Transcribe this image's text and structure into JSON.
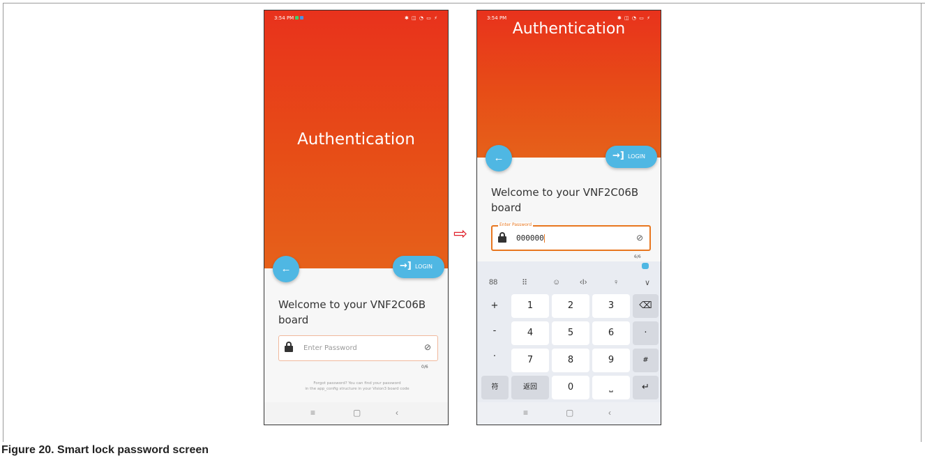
{
  "caption": "Figure 20.  Smart lock password screen",
  "status_bar": {
    "time": "3:54 PM",
    "icons": "✱ ◫ ◔ ▭ ⚡",
    "dot_colors": [
      "#3fd06a",
      "#4a90e2"
    ]
  },
  "screen1": {
    "title": "Authentication",
    "back_icon": "←",
    "login_icon": "→]",
    "login_label": "LOGIN",
    "welcome": "Welcome to your VNF2C06B board",
    "password_placeholder": "Enter Password",
    "eye_icon": "⊘",
    "counter": "0/6",
    "forgot_line1": "Forgot password? You can find your password",
    "forgot_line2": "in the app_config structure in your Vision3 board code"
  },
  "arrow": "⇨",
  "screen2": {
    "title": "Authentication",
    "back_icon": "←",
    "login_icon": "→]",
    "login_label": "LOGIN",
    "welcome": "Welcome to your VNF2C06B board",
    "password_label": "Enter Password",
    "password_value": "000000",
    "eye_icon": "⊘",
    "counter": "6/6"
  },
  "keyboard": {
    "toolbar": [
      "88",
      "⠿",
      "☺",
      "‹I›",
      "♀",
      "∨"
    ],
    "side_left": [
      "+",
      "-",
      ".",
      ","
    ],
    "rows": [
      [
        "1",
        "2",
        "3"
      ],
      [
        "4",
        "5",
        "6"
      ],
      [
        "7",
        "8",
        "9"
      ]
    ],
    "side_right": [
      "⌫",
      "·",
      "#"
    ],
    "bottom": {
      "symbols": "符",
      "back": "返回",
      "zero": "0",
      "space": "⎵",
      "enter": "↵"
    }
  },
  "nav": [
    "≡",
    "▢",
    "‹"
  ],
  "colors": {
    "hero_top": "#e8321c",
    "hero_bottom": "#e6611a",
    "accent_blue": "#4fb7e3",
    "field_orange": "#e8761e",
    "arrow_red": "#e0202a"
  }
}
